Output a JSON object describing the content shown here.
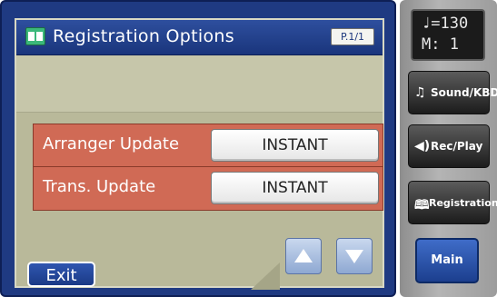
{
  "window": {
    "title": "Registration Options",
    "page": "P.1/1"
  },
  "options": [
    {
      "label": "Arranger Update",
      "value": "INSTANT"
    },
    {
      "label": "Trans. Update",
      "value": "INSTANT"
    }
  ],
  "footer": {
    "exit_label": "Exit"
  },
  "side_panel": {
    "tempo_line": "♩=130",
    "measure_line": "M:   1",
    "buttons": [
      {
        "label": "Sound/KBD",
        "icon": "music-note-icon"
      },
      {
        "label": "Rec/Play",
        "icon": "speaker-icon"
      },
      {
        "label": "Registration",
        "icon": "book-icon"
      }
    ],
    "main_label": "Main"
  },
  "colors": {
    "screen_frame": "#1f3a82",
    "content_bg": "#b9b99a",
    "row_bg": "#d06a55",
    "value_button": "#ffffff"
  }
}
